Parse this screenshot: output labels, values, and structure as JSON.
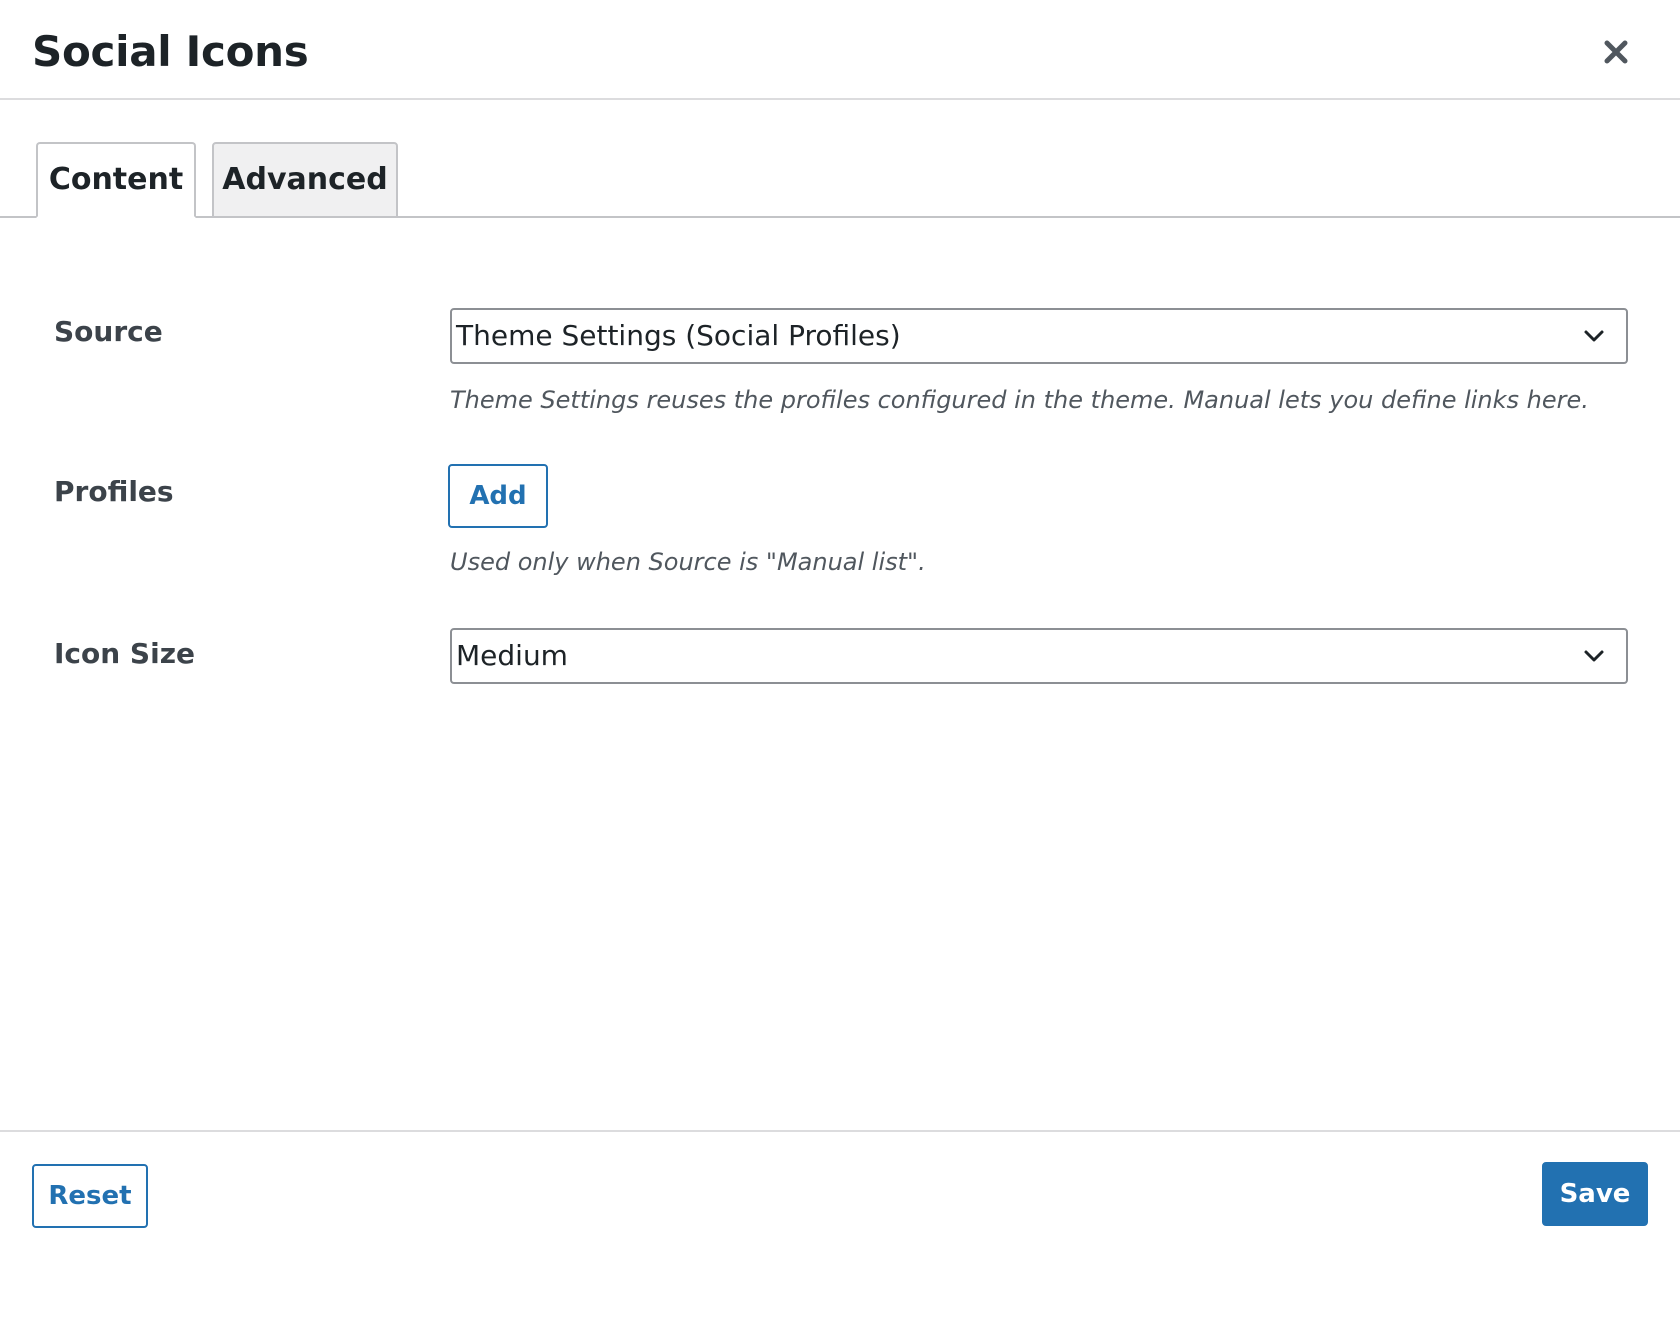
{
  "dialog": {
    "title": "Social Icons",
    "close_icon": "close-icon"
  },
  "tabs": [
    {
      "label": "Content",
      "active": true
    },
    {
      "label": "Advanced",
      "active": false
    }
  ],
  "fields": {
    "source": {
      "label": "Source",
      "value": "Theme Settings (Social Profiles)",
      "help": "Theme Settings reuses the profiles configured in the theme. Manual lets you define links here."
    },
    "profiles": {
      "label": "Profiles",
      "add_label": "Add",
      "help": "Used only when Source is \"Manual list\"."
    },
    "icon_size": {
      "label": "Icon Size",
      "value": "Medium"
    }
  },
  "footer": {
    "reset_label": "Reset",
    "save_label": "Save"
  },
  "colors": {
    "accent": "#2271b1",
    "text": "#1d2327",
    "muted": "#50575e",
    "border": "#8c8f94"
  }
}
